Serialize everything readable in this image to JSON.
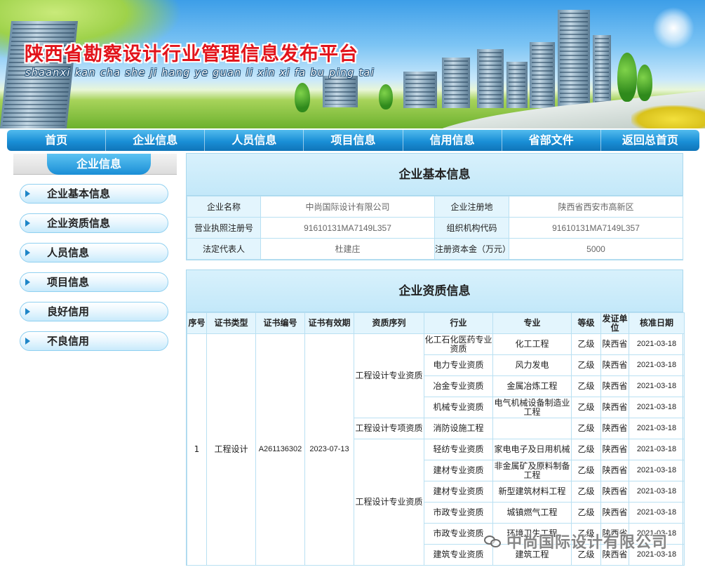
{
  "header": {
    "title": "陕西省勘察设计行业管理信息发布平台",
    "subtitle": "shaanxi kan cha she ji hang ye guan li xin xi fa bu ping tai"
  },
  "nav": {
    "items": [
      "首页",
      "企业信息",
      "人员信息",
      "项目信息",
      "信用信息",
      "省部文件",
      "返回总首页"
    ]
  },
  "sidebar": {
    "heading": "企业信息",
    "items": [
      "企业基本信息",
      "企业资质信息",
      "人员信息",
      "项目信息",
      "良好信用",
      "不良信用"
    ]
  },
  "basic_info": {
    "title": "企业基本信息",
    "rows": [
      {
        "k1": "企业名称",
        "v1": "中尚国际设计有限公司",
        "k2": "企业注册地",
        "v2": "陕西省西安市高新区"
      },
      {
        "k1": "营业执照注册号",
        "v1": "91610131MA7149L357",
        "k2": "组织机构代码",
        "v2": "91610131MA7149L357"
      },
      {
        "k1": "法定代表人",
        "v1": "杜建庄",
        "k2": "注册资本金（万元）",
        "v2": "5000"
      }
    ]
  },
  "qualification": {
    "title": "企业资质信息",
    "headers": [
      "序号",
      "证书类型",
      "证书编号",
      "证书有效期",
      "资质序列",
      "行业",
      "专业",
      "等级",
      "发证单位",
      "核准日期"
    ],
    "cert": {
      "no": "1",
      "type": "工程设计",
      "number": "A261136302",
      "valid": "2023-07-13"
    },
    "series": [
      "工程设计专业资质",
      "工程设计专项资质",
      "工程设计专业资质"
    ],
    "rows": [
      {
        "industry": "化工石化医药专业资质",
        "major": "化工工程",
        "grade": "乙级",
        "issuer": "陕西省",
        "date": "2021-03-18"
      },
      {
        "industry": "电力专业资质",
        "major": "风力发电",
        "grade": "乙级",
        "issuer": "陕西省",
        "date": "2021-03-18"
      },
      {
        "industry": "冶金专业资质",
        "major": "金属冶炼工程",
        "grade": "乙级",
        "issuer": "陕西省",
        "date": "2021-03-18"
      },
      {
        "industry": "机械专业资质",
        "major": "电气机械设备制造业工程",
        "grade": "乙级",
        "issuer": "陕西省",
        "date": "2021-03-18"
      },
      {
        "industry": "消防设施工程",
        "major": "",
        "grade": "乙级",
        "issuer": "陕西省",
        "date": "2021-03-18"
      },
      {
        "industry": "轻纺专业资质",
        "major": "家电电子及日用机械",
        "grade": "乙级",
        "issuer": "陕西省",
        "date": "2021-03-18"
      },
      {
        "industry": "建材专业资质",
        "major": "非金属矿及原料制备工程",
        "grade": "乙级",
        "issuer": "陕西省",
        "date": "2021-03-18"
      },
      {
        "industry": "建材专业资质",
        "major": "新型建筑材料工程",
        "grade": "乙级",
        "issuer": "陕西省",
        "date": "2021-03-18"
      },
      {
        "industry": "市政专业资质",
        "major": "城镇燃气工程",
        "grade": "乙级",
        "issuer": "陕西省",
        "date": "2021-03-18"
      },
      {
        "industry": "市政专业资质",
        "major": "环境卫生工程",
        "grade": "乙级",
        "issuer": "陕西省",
        "date": "2021-03-18"
      },
      {
        "industry": "建筑专业资质",
        "major": "建筑工程",
        "grade": "乙级",
        "issuer": "陕西省",
        "date": "2021-03-18"
      }
    ]
  },
  "watermark": {
    "text": "中尚国际设计有限公司"
  }
}
